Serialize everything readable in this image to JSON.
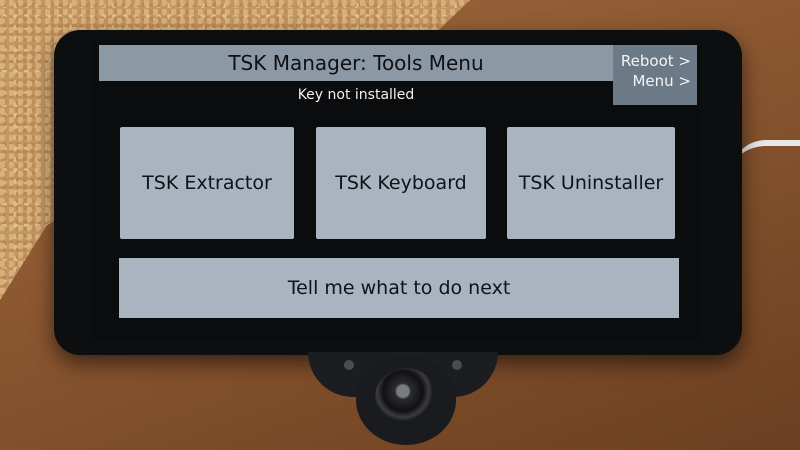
{
  "header": {
    "title": "TSK Manager: Tools Menu",
    "status": "Key not installed"
  },
  "reboot_button": {
    "line1": "Reboot >",
    "line2": "Menu >"
  },
  "tools": [
    {
      "label": "TSK Extractor"
    },
    {
      "label": "TSK Keyboard"
    },
    {
      "label": "TSK Uninstaller"
    }
  ],
  "next_button": {
    "label": "Tell me what to do next"
  },
  "colors": {
    "header_bg": "#8c98a4",
    "tile_bg": "#a9b4c0",
    "reboot_bg": "#6c7a88",
    "screen_bg": "#0b0c0e"
  }
}
